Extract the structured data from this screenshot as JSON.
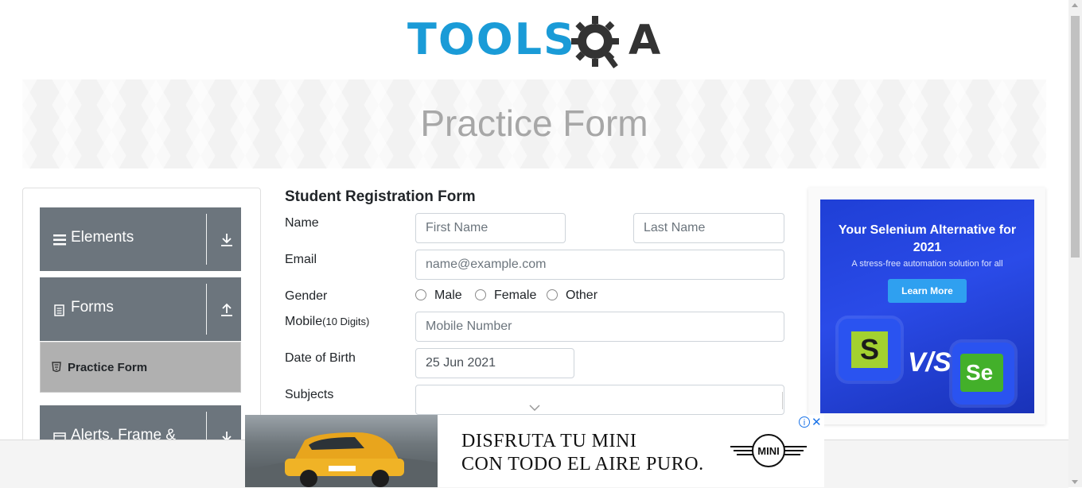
{
  "logo": {
    "text": "TOOLS",
    "letter": "A"
  },
  "banner": {
    "title": "Practice Form"
  },
  "sidebar": {
    "groups": [
      {
        "label": "Elements",
        "icon": "list-icon",
        "toggle": "download-arrow-icon"
      },
      {
        "label": "Forms",
        "icon": "document-icon",
        "toggle": "upload-arrow-icon"
      },
      {
        "label": "Alerts, Frame &",
        "icon": "window-icon",
        "toggle": "download-arrow-icon"
      }
    ],
    "active_item": {
      "label": "Practice Form",
      "icon": "html5-icon"
    }
  },
  "form": {
    "title": "Student Registration Form",
    "name_label": "Name",
    "first_name_placeholder": "First Name",
    "last_name_placeholder": "Last Name",
    "email_label": "Email",
    "email_placeholder": "name@example.com",
    "gender_label": "Gender",
    "gender_options": [
      "Male",
      "Female",
      "Other"
    ],
    "mobile_label": "Mobile",
    "mobile_hint": "(10 Digits)",
    "mobile_placeholder": "Mobile Number",
    "dob_label": "Date of Birth",
    "dob_value": "25 Jun 2021",
    "subjects_label": "Subjects"
  },
  "side_ad": {
    "headline": "Your Selenium Alternative for 2021",
    "subline": "A stress-free automation solution for all",
    "button": "Learn More",
    "vs_text": "V/S",
    "left_tile": "S",
    "right_tile": "Se"
  },
  "bottom_ad": {
    "line1": "DISFRUTA TU MINI",
    "line2": "CON TODO EL AIRE PURO.",
    "brand": "MINI",
    "info": "i",
    "close": "✕"
  },
  "colors": {
    "brand_blue": "#1a9bd7",
    "sidebar_header": "#6c757d",
    "ad_blue": "#2a4be8"
  }
}
